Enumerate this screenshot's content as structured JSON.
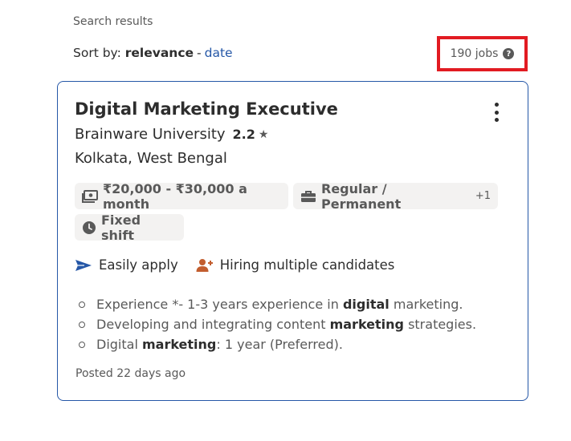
{
  "results": {
    "label": "Search results",
    "sort_prefix": "Sort by:",
    "sort_active": "relevance",
    "sort_separator": "-",
    "sort_alt": "date",
    "job_count": "190 jobs",
    "help_symbol": "?"
  },
  "job": {
    "title": "Digital Marketing Executive",
    "company": "Brainware University",
    "rating": "2.2",
    "star": "★",
    "location": "Kolkata, West Bengal",
    "salary": "₹20,000 - ₹30,000 a month",
    "job_type": "Regular / Permanent",
    "job_type_more": "+1",
    "shift": "Fixed shift",
    "attributes": {
      "easy_apply": "Easily apply",
      "hiring_multiple": "Hiring multiple candidates"
    },
    "snippet": [
      {
        "before": "Experience *- 1-3 years experience in ",
        "bold": "digital",
        "after": " marketing."
      },
      {
        "before": "Developing and integrating content ",
        "bold": "marketing",
        "after": " strategies."
      },
      {
        "before": "Digital ",
        "bold": "marketing",
        "after": ": 1 year (Preferred)."
      }
    ],
    "posted": "Posted 22 days ago"
  },
  "icons": {
    "salary": "money-icon",
    "job_type": "briefcase-icon",
    "shift": "clock-icon",
    "easy_apply": "send-arrow-icon",
    "hiring": "person-add-icon",
    "menu": "kebab-menu-icon",
    "help": "help-icon"
  },
  "colors": {
    "link": "#2557a7",
    "highlight_box": "#e21b22",
    "accent_orange": "#c25d2e",
    "chip_bg": "#f3f2f1"
  }
}
